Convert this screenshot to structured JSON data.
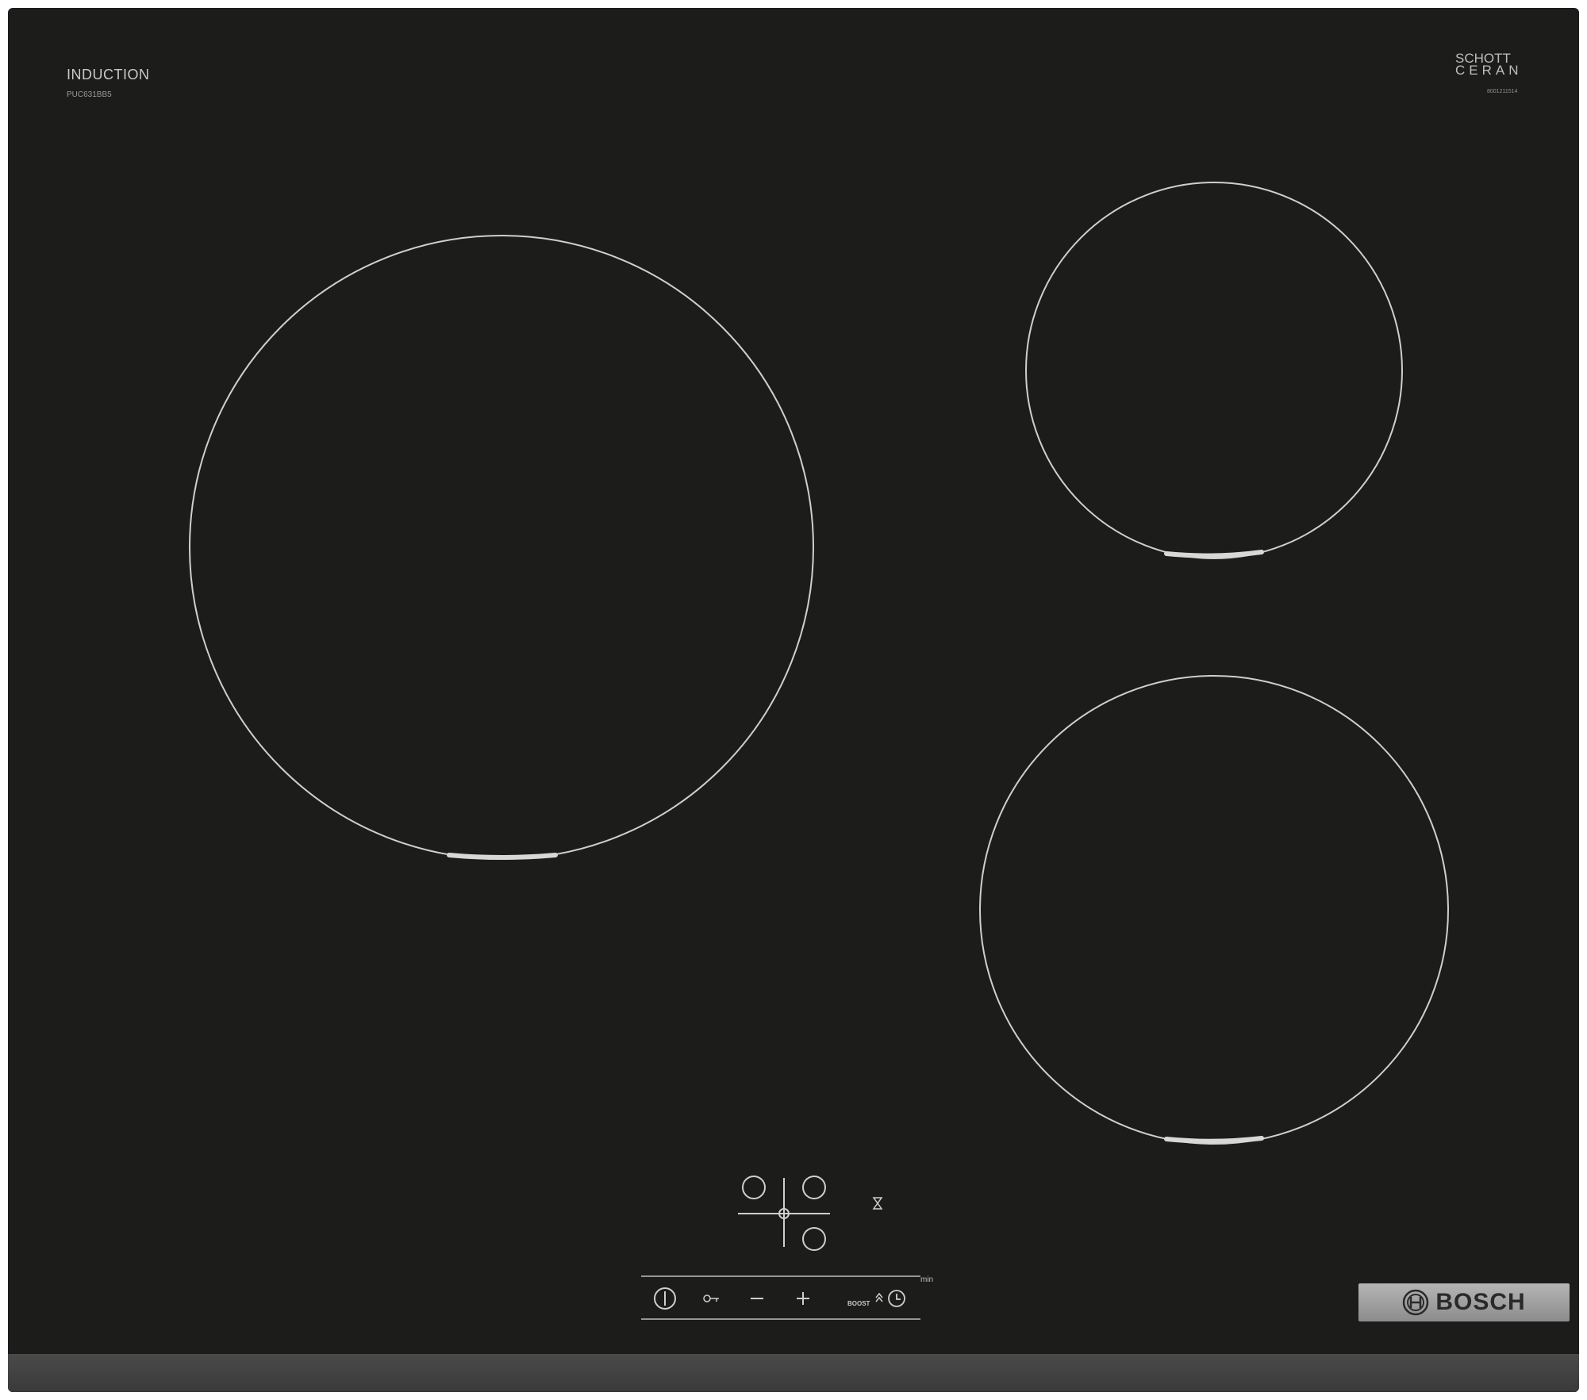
{
  "hob": {
    "type_label": "INDUCTION",
    "model": "PUC631BB5",
    "glass_brand_line1": "SCHOTT",
    "glass_brand_line2": "CERAN",
    "serial": "8001211514"
  },
  "controls": {
    "buttons": [
      {
        "name": "power-icon"
      },
      {
        "name": "lock-icon"
      },
      {
        "name": "minus-icon"
      },
      {
        "name": "plus-icon"
      },
      {
        "name": "boost-label",
        "label": "BOOST"
      },
      {
        "name": "timer-icon"
      }
    ],
    "timer_unit": "min",
    "zone_selectors": [
      "zone-front-left",
      "zone-rear-right",
      "zone-front-right"
    ]
  },
  "brand": {
    "name": "BOSCH"
  },
  "colors": {
    "glass": "#1c1c1b",
    "ring": "#cfcfcf",
    "badge": "#a6a6a6"
  }
}
